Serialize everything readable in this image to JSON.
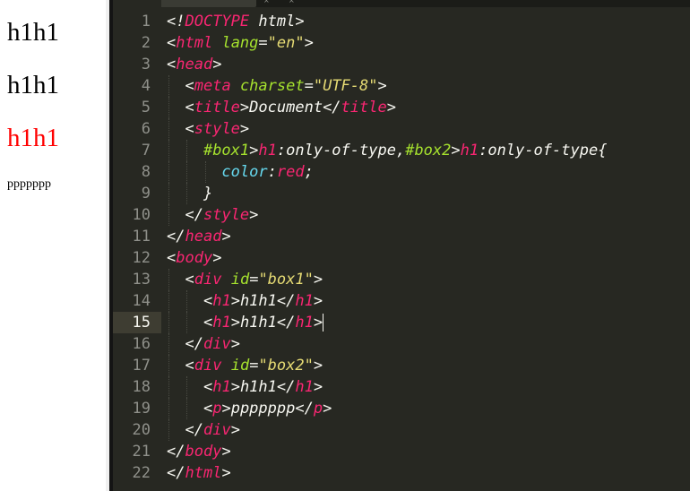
{
  "preview": {
    "lines": [
      {
        "text": "h1h1",
        "color": "#000000"
      },
      {
        "text": "h1h1",
        "color": "#000000"
      },
      {
        "text": "h1h1",
        "color": "#ff0000"
      }
    ],
    "paragraph": "ppppppp"
  },
  "editor": {
    "current_line": 15,
    "line_numbers": [
      "1",
      "2",
      "3",
      "4",
      "5",
      "6",
      "7",
      "8",
      "9",
      "10",
      "11",
      "12",
      "13",
      "14",
      "15",
      "16",
      "17",
      "18",
      "19",
      "20",
      "21",
      "22"
    ],
    "lines": [
      [
        [
          "t-punc",
          "<!"
        ],
        [
          "t-doctype",
          "DOCTYPE"
        ],
        [
          "t-text",
          " html"
        ],
        [
          "t-punc",
          ">"
        ]
      ],
      [
        [
          "t-punc",
          "<"
        ],
        [
          "t-tag",
          "html"
        ],
        [
          "t-text",
          " "
        ],
        [
          "t-attr",
          "lang"
        ],
        [
          "t-punc",
          "="
        ],
        [
          "t-str",
          "\"en\""
        ],
        [
          "t-punc",
          ">"
        ]
      ],
      [
        [
          "t-punc",
          "<"
        ],
        [
          "t-tag",
          "head"
        ],
        [
          "t-punc",
          ">"
        ]
      ],
      [
        [
          "t-text",
          "  "
        ],
        [
          "t-punc",
          "<"
        ],
        [
          "t-tag",
          "meta"
        ],
        [
          "t-text",
          " "
        ],
        [
          "t-attr",
          "charset"
        ],
        [
          "t-punc",
          "="
        ],
        [
          "t-str",
          "\"UTF-8\""
        ],
        [
          "t-punc",
          ">"
        ]
      ],
      [
        [
          "t-text",
          "  "
        ],
        [
          "t-punc",
          "<"
        ],
        [
          "t-tag",
          "title"
        ],
        [
          "t-punc",
          ">"
        ],
        [
          "t-text",
          "Document"
        ],
        [
          "t-punc",
          "</"
        ],
        [
          "t-tag",
          "title"
        ],
        [
          "t-punc",
          ">"
        ]
      ],
      [
        [
          "t-text",
          "  "
        ],
        [
          "t-punc",
          "<"
        ],
        [
          "t-tag",
          "style"
        ],
        [
          "t-punc",
          ">"
        ]
      ],
      [
        [
          "t-text",
          "    "
        ],
        [
          "t-attr",
          "#box1"
        ],
        [
          "t-punc",
          ">"
        ],
        [
          "t-tag",
          "h1"
        ],
        [
          "t-punc",
          ":"
        ],
        [
          "t-text",
          "only-of-type"
        ],
        [
          "t-punc",
          ","
        ],
        [
          "t-attr",
          "#box2"
        ],
        [
          "t-punc",
          ">"
        ],
        [
          "t-tag",
          "h1"
        ],
        [
          "t-punc",
          ":"
        ],
        [
          "t-text",
          "only-of-type"
        ],
        [
          "t-punc",
          "{"
        ]
      ],
      [
        [
          "t-text",
          "      "
        ],
        [
          "t-prop",
          "color"
        ],
        [
          "t-punc",
          ":"
        ],
        [
          "t-val",
          "red"
        ],
        [
          "t-punc",
          ";"
        ]
      ],
      [
        [
          "t-text",
          "    "
        ],
        [
          "t-punc",
          "}"
        ]
      ],
      [
        [
          "t-text",
          "  "
        ],
        [
          "t-punc",
          "</"
        ],
        [
          "t-tag",
          "style"
        ],
        [
          "t-punc",
          ">"
        ]
      ],
      [
        [
          "t-punc",
          "</"
        ],
        [
          "t-tag",
          "head"
        ],
        [
          "t-punc",
          ">"
        ]
      ],
      [
        [
          "t-punc",
          "<"
        ],
        [
          "t-tag",
          "body"
        ],
        [
          "t-punc",
          ">"
        ]
      ],
      [
        [
          "t-text",
          "  "
        ],
        [
          "t-punc",
          "<"
        ],
        [
          "t-tag",
          "div"
        ],
        [
          "t-text",
          " "
        ],
        [
          "t-attr",
          "id"
        ],
        [
          "t-punc",
          "="
        ],
        [
          "t-str",
          "\"box1\""
        ],
        [
          "t-punc",
          ">"
        ]
      ],
      [
        [
          "t-text",
          "    "
        ],
        [
          "t-punc",
          "<"
        ],
        [
          "t-tag",
          "h1"
        ],
        [
          "t-punc",
          ">"
        ],
        [
          "t-text",
          "h1h1"
        ],
        [
          "t-punc",
          "</"
        ],
        [
          "t-tag",
          "h1"
        ],
        [
          "t-punc",
          ">"
        ]
      ],
      [
        [
          "t-text",
          "    "
        ],
        [
          "t-punc",
          "<"
        ],
        [
          "t-tag",
          "h1"
        ],
        [
          "t-punc",
          ">"
        ],
        [
          "t-text",
          "h1h1"
        ],
        [
          "t-punc",
          "</"
        ],
        [
          "t-tag",
          "h1"
        ],
        [
          "t-punc",
          ">"
        ]
      ],
      [
        [
          "t-text",
          "  "
        ],
        [
          "t-punc",
          "</"
        ],
        [
          "t-tag",
          "div"
        ],
        [
          "t-punc",
          ">"
        ]
      ],
      [
        [
          "t-text",
          "  "
        ],
        [
          "t-punc",
          "<"
        ],
        [
          "t-tag",
          "div"
        ],
        [
          "t-text",
          " "
        ],
        [
          "t-attr",
          "id"
        ],
        [
          "t-punc",
          "="
        ],
        [
          "t-str",
          "\"box2\""
        ],
        [
          "t-punc",
          ">"
        ]
      ],
      [
        [
          "t-text",
          "    "
        ],
        [
          "t-punc",
          "<"
        ],
        [
          "t-tag",
          "h1"
        ],
        [
          "t-punc",
          ">"
        ],
        [
          "t-text",
          "h1h1"
        ],
        [
          "t-punc",
          "</"
        ],
        [
          "t-tag",
          "h1"
        ],
        [
          "t-punc",
          ">"
        ]
      ],
      [
        [
          "t-text",
          "    "
        ],
        [
          "t-punc",
          "<"
        ],
        [
          "t-tag",
          "p"
        ],
        [
          "t-punc",
          ">"
        ],
        [
          "t-text",
          "ppppppp"
        ],
        [
          "t-punc",
          "</"
        ],
        [
          "t-tag",
          "p"
        ],
        [
          "t-punc",
          ">"
        ]
      ],
      [
        [
          "t-text",
          "  "
        ],
        [
          "t-punc",
          "</"
        ],
        [
          "t-tag",
          "div"
        ],
        [
          "t-punc",
          ">"
        ]
      ],
      [
        [
          "t-punc",
          "</"
        ],
        [
          "t-tag",
          "body"
        ],
        [
          "t-punc",
          ">"
        ]
      ],
      [
        [
          "t-punc",
          "</"
        ],
        [
          "t-tag",
          "html"
        ],
        [
          "t-punc",
          ">"
        ]
      ]
    ]
  },
  "colors": {
    "editor_bg": "#272822",
    "gutter_text": "#8f908a",
    "tag": "#f92672",
    "attribute": "#a6e22e",
    "string": "#e6db74",
    "property": "#66d9ef",
    "text": "#f8f8f2"
  }
}
